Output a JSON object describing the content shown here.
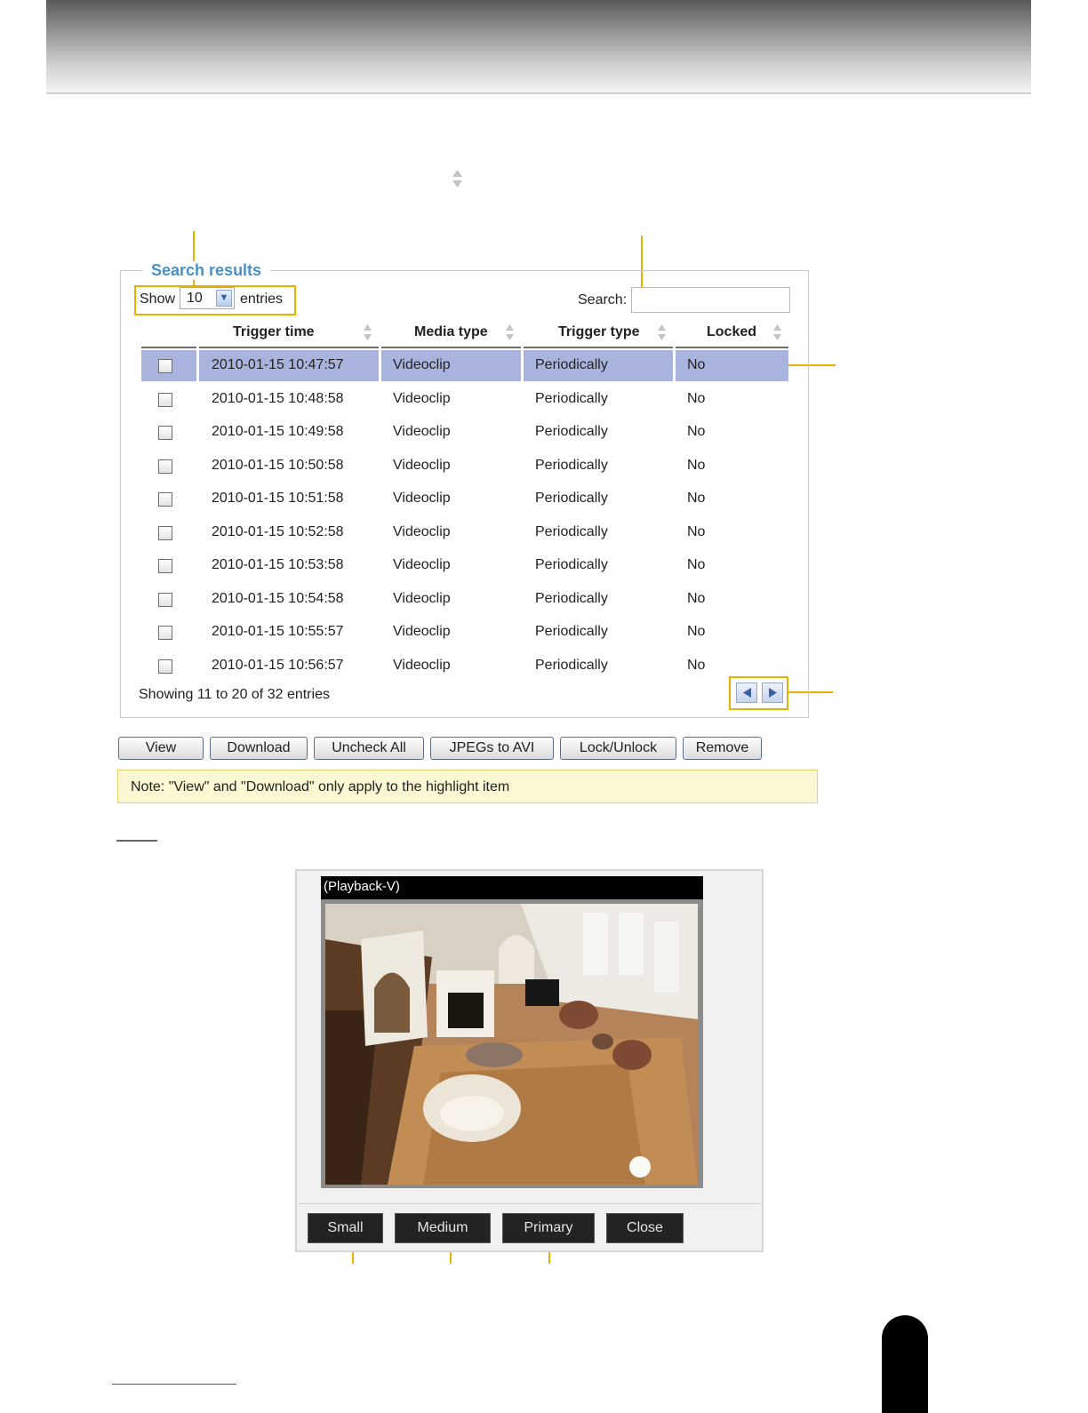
{
  "search_results": {
    "legend": "Search results",
    "show_label": "Show",
    "page_length": "10",
    "entries_label": "entries",
    "search_label": "Search:",
    "search_value": "",
    "columns": [
      "Trigger time",
      "Media type",
      "Trigger type",
      "Locked"
    ],
    "rows": [
      {
        "time": "2010-01-15 10:47:57",
        "media": "Videoclip",
        "trigger": "Periodically",
        "locked": "No"
      },
      {
        "time": "2010-01-15 10:48:58",
        "media": "Videoclip",
        "trigger": "Periodically",
        "locked": "No"
      },
      {
        "time": "2010-01-15 10:49:58",
        "media": "Videoclip",
        "trigger": "Periodically",
        "locked": "No"
      },
      {
        "time": "2010-01-15 10:50:58",
        "media": "Videoclip",
        "trigger": "Periodically",
        "locked": "No"
      },
      {
        "time": "2010-01-15 10:51:58",
        "media": "Videoclip",
        "trigger": "Periodically",
        "locked": "No"
      },
      {
        "time": "2010-01-15 10:52:58",
        "media": "Videoclip",
        "trigger": "Periodically",
        "locked": "No"
      },
      {
        "time": "2010-01-15 10:53:58",
        "media": "Videoclip",
        "trigger": "Periodically",
        "locked": "No"
      },
      {
        "time": "2010-01-15 10:54:58",
        "media": "Videoclip",
        "trigger": "Periodically",
        "locked": "No"
      },
      {
        "time": "2010-01-15 10:55:57",
        "media": "Videoclip",
        "trigger": "Periodically",
        "locked": "No"
      },
      {
        "time": "2010-01-15 10:56:57",
        "media": "Videoclip",
        "trigger": "Periodically",
        "locked": "No"
      }
    ],
    "info": "Showing 11 to 20 of 32 entries"
  },
  "actions": {
    "view": "View",
    "download": "Download",
    "uncheck_all": "Uncheck All",
    "jpegs_to_avi": "JPEGs to AVI",
    "lock_unlock": "Lock/Unlock",
    "remove": "Remove"
  },
  "note": "Note: \"View\" and \"Download\" only apply to the highlight item",
  "player": {
    "title": "(Playback-V)",
    "small": "Small",
    "medium": "Medium",
    "primary": "Primary",
    "close": "Close"
  },
  "colors": {
    "callout": "#e8b100",
    "highlight_row": "#a8b4de",
    "legend": "#4a90c8",
    "note_bg": "#fbf8d3"
  }
}
